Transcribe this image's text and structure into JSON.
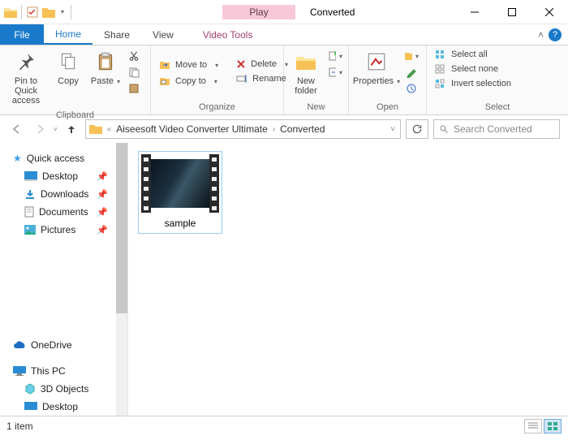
{
  "titlebar": {
    "context_tab": "Play",
    "app_title": "Converted"
  },
  "tabs": {
    "file": "File",
    "home": "Home",
    "share": "Share",
    "view": "View",
    "video_tools": "Video Tools"
  },
  "ribbon": {
    "clipboard": {
      "label": "Clipboard",
      "pin": "Pin to Quick access",
      "copy": "Copy",
      "paste": "Paste"
    },
    "organize": {
      "label": "Organize",
      "move_to": "Move to",
      "copy_to": "Copy to",
      "delete": "Delete",
      "rename": "Rename"
    },
    "new": {
      "label": "New",
      "new_folder": "New folder"
    },
    "open": {
      "label": "Open",
      "properties": "Properties"
    },
    "select": {
      "label": "Select",
      "select_all": "Select all",
      "select_none": "Select none",
      "invert": "Invert selection"
    }
  },
  "address": {
    "prefix": "«",
    "crumb1": "Aiseesoft Video Converter Ultimate",
    "crumb2": "Converted"
  },
  "search": {
    "placeholder": "Search Converted"
  },
  "nav": {
    "quick_access": "Quick access",
    "desktop": "Desktop",
    "downloads": "Downloads",
    "documents": "Documents",
    "pictures": "Pictures",
    "onedrive": "OneDrive",
    "this_pc": "This PC",
    "three_d": "3D Objects",
    "desktop2": "Desktop"
  },
  "files": {
    "item1": "sample"
  },
  "status": {
    "count": "1 item"
  }
}
